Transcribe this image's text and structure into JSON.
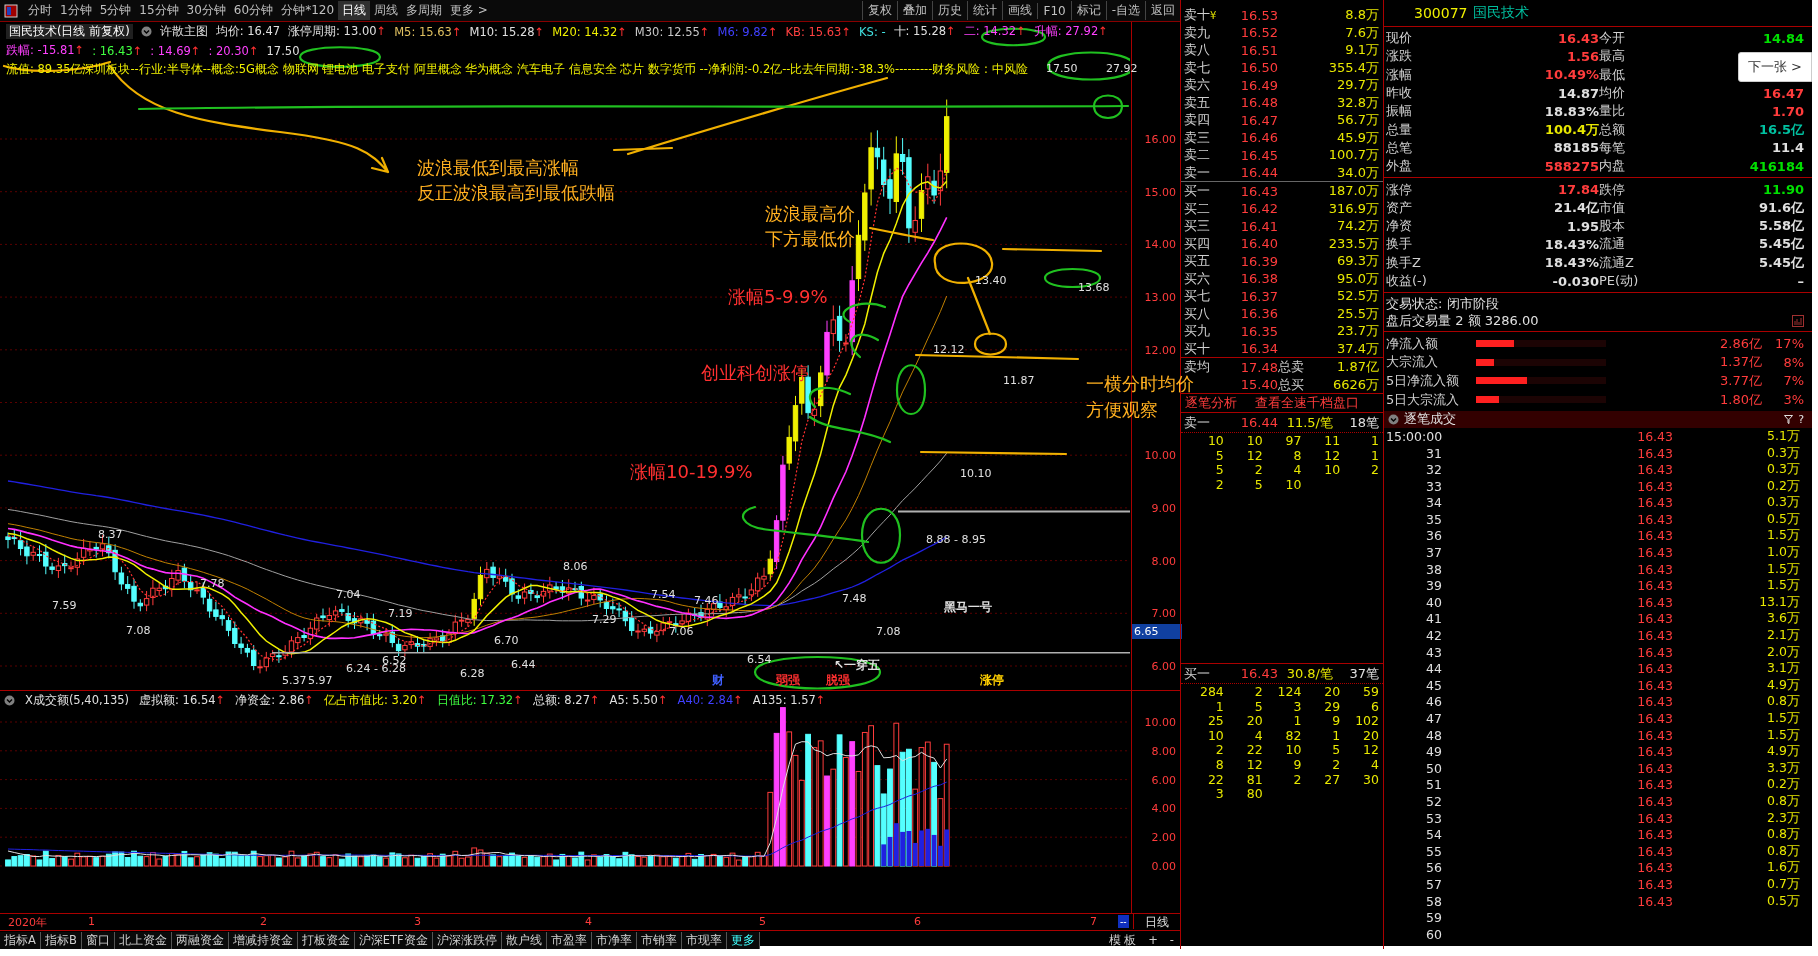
{
  "toolbar": {
    "periods": [
      {
        "label": "分时",
        "selected": false
      },
      {
        "label": "1分钟",
        "selected": false
      },
      {
        "label": "5分钟",
        "selected": false
      },
      {
        "label": "15分钟",
        "selected": false
      },
      {
        "label": "30分钟",
        "selected": false
      },
      {
        "label": "60分钟",
        "selected": false
      },
      {
        "label": "分钟*120",
        "selected": false
      },
      {
        "label": "日线",
        "selected": true
      },
      {
        "label": "周线",
        "selected": false
      },
      {
        "label": "多周期",
        "selected": false
      },
      {
        "label": "更多 >",
        "selected": false
      }
    ],
    "actions": [
      "复权",
      "叠加",
      "历史",
      "统计",
      "画线",
      "F10",
      "标记",
      "-自选",
      "返回"
    ]
  },
  "chart": {
    "title": "国民技术(日线 前复权)",
    "template": "许散主图",
    "indicators": [
      {
        "text": "均价: 16.47",
        "color": "#e0e0e0"
      },
      {
        "text": "涨停周期: 13.00",
        "arrow": "↑",
        "color": "#e0e0e0"
      },
      {
        "text": "M5: 15.63",
        "arrow": "↑",
        "color": "#e0c060"
      },
      {
        "text": "M10: 15.28",
        "arrow": "↑",
        "color": "#e0e0e0"
      },
      {
        "text": "M20: 14.32",
        "arrow": "↑",
        "color": "#f0f000"
      },
      {
        "text": "M30: 12.55",
        "arrow": "↑",
        "color": "#c8c8c8"
      },
      {
        "text": "M6: 9.82",
        "arrow": "↑",
        "color": "#4040ff"
      },
      {
        "text": "KB: 15.63",
        "arrow": "↑",
        "color": "#ff4040"
      },
      {
        "text": "KS: -",
        "color": "#40e0e0"
      },
      {
        "text": "十: 15.28",
        "arrow": "↑",
        "color": "#e0e0e0"
      },
      {
        "text": "二: 14.32",
        "arrow": "↑",
        "color": "#ff40ff"
      },
      {
        "text": "升幅: 27.92",
        "arrow": "↑",
        "color": "#ff40ff"
      }
    ],
    "indicators2": [
      {
        "text": "跌幅: -15.81",
        "arrow": "↑",
        "color": "#ff40ff"
      },
      {
        "text": ": 16.43",
        "arrow": "↑",
        "color": "#40ff40"
      },
      {
        "text": ": 14.69",
        "arrow": "↑",
        "color": "#ff40ff"
      },
      {
        "text": ": 20.30",
        "arrow": "↑",
        "color": "#ff40ff"
      },
      {
        "text": "17.50",
        "color": "#e0e0e0"
      }
    ],
    "info": "流值: 89.35亿深圳板块--行业:半导体--概念:5G概念 物联网 锂电池 电子支付 阿里概念 华为概念 汽车电子 信息安全 芯片 数字货币 --净利润:-0.2亿--比去年同期:-38.3%---------财务风险 : 中风险",
    "price_axis": [
      "16.00",
      "15.00",
      "14.00",
      "13.00",
      "12.00",
      "10.00",
      "9.00",
      "8.00",
      "7.00",
      "6.00"
    ],
    "current_price_marker": "6.65",
    "price_labels": [
      "8.37",
      "7.59",
      "7.78",
      "7.08",
      "5.37",
      "5.97",
      "7.04",
      "6.24 - 6.28",
      "7.19",
      "6.52",
      "6.28",
      "6.70",
      "6.44",
      "8.06",
      "7.29",
      "7.54",
      "7.46",
      "7.06",
      "6.54",
      "7.48",
      "7.08",
      "13.40",
      "12.12",
      "11.87",
      "10.10",
      "8.88 - 8.95",
      "17.50",
      "27.92",
      "13.68"
    ],
    "signals": [
      {
        "text": "黑马一号",
        "color": "#e0e0e0"
      },
      {
        "text": "↖一穿五",
        "color": "#e0e0e0"
      },
      {
        "text": "财",
        "color": "#4060ff"
      },
      {
        "text": "弱强",
        "color": "#ff3030"
      },
      {
        "text": "脱强",
        "color": "#ff3030"
      },
      {
        "text": "涨停",
        "color": "#ffd000"
      }
    ],
    "notes": [
      {
        "text": "波浪最低到最高涨幅",
        "color": "#ffb020"
      },
      {
        "text": "反正波浪最高到最低跌幅",
        "color": "#ffb020"
      },
      {
        "text": "波浪最高价",
        "color": "#ffb020"
      },
      {
        "text": "下方最低价",
        "color": "#ffb020"
      },
      {
        "text": "涨幅5-9.9%",
        "color": "#ff3030"
      },
      {
        "text": "创业科创涨停",
        "color": "#ff3030"
      },
      {
        "text": "涨幅10-19.9%",
        "color": "#ff3030"
      },
      {
        "text": "一横分时均价",
        "color": "#ffb020"
      },
      {
        "text": "方便观察",
        "color": "#ffb020"
      }
    ]
  },
  "volume": {
    "title": "X成交额(5,40,135)",
    "indicators": [
      {
        "text": "虚拟额: 16.54",
        "arrow": "↑",
        "color": "#e0e0e0"
      },
      {
        "text": "净资金: 2.86",
        "arrow": "↑",
        "color": "#e0e0e0"
      },
      {
        "text": "亿占市值比: 3.20",
        "arrow": "↑",
        "color": "#f0f000"
      },
      {
        "text": "日值比: 17.32",
        "arrow": "↑",
        "color": "#40ff40"
      },
      {
        "text": "总额: 8.27",
        "arrow": "↑",
        "color": "#e0e0e0"
      },
      {
        "text": "A5: 5.50",
        "arrow": "↑",
        "color": "#e0e0e0"
      },
      {
        "text": "A40: 2.84",
        "arrow": "↑",
        "color": "#4040ff"
      },
      {
        "text": "A135: 1.57",
        "arrow": "↑",
        "color": "#e0e0e0"
      }
    ],
    "axis": [
      "10.00",
      "8.00",
      "6.00",
      "4.00",
      "2.00",
      "0.00"
    ]
  },
  "date_axis": {
    "labels": [
      "2020年",
      "1",
      "2",
      "3",
      "4",
      "5",
      "6",
      "7"
    ],
    "scroll": "--",
    "period": "日线"
  },
  "bottom_tabs": [
    {
      "label": "指标A",
      "selected": false
    },
    {
      "label": "指标B",
      "selected": false
    },
    {
      "label": "窗口",
      "selected": false
    },
    {
      "label": "北上资金",
      "selected": false
    },
    {
      "label": "两融资金",
      "selected": false
    },
    {
      "label": "增减持资金",
      "selected": false
    },
    {
      "label": "打板资金",
      "selected": false
    },
    {
      "label": "沪深ETF资金",
      "selected": false
    },
    {
      "label": "沪深涨跌停",
      "selected": false
    },
    {
      "label": "散户线",
      "selected": false
    },
    {
      "label": "市盈率",
      "selected": false
    },
    {
      "label": "市净率",
      "selected": false
    },
    {
      "label": "市销率",
      "selected": false
    },
    {
      "label": "市现率",
      "selected": false
    },
    {
      "label": "更多",
      "selected": false
    }
  ],
  "bottom_buttons": [
    "模 板",
    "+",
    "-"
  ],
  "order_book": {
    "asks": [
      {
        "label": "卖十",
        "flag": "¥",
        "price": "16.53",
        "volume": "8.8万"
      },
      {
        "label": "卖九",
        "price": "16.52",
        "volume": "7.6万"
      },
      {
        "label": "卖八",
        "price": "16.51",
        "volume": "9.1万"
      },
      {
        "label": "卖七",
        "price": "16.50",
        "volume": "355.4万"
      },
      {
        "label": "卖六",
        "price": "16.49",
        "volume": "29.7万"
      },
      {
        "label": "卖五",
        "price": "16.48",
        "volume": "32.8万"
      },
      {
        "label": "卖四",
        "price": "16.47",
        "volume": "56.7万"
      },
      {
        "label": "卖三",
        "price": "16.46",
        "volume": "45.9万"
      },
      {
        "label": "卖二",
        "price": "16.45",
        "volume": "100.7万"
      },
      {
        "label": "卖一",
        "price": "16.44",
        "volume": "34.0万"
      }
    ],
    "bids": [
      {
        "label": "买一",
        "price": "16.43",
        "volume": "187.0万"
      },
      {
        "label": "买二",
        "price": "16.42",
        "volume": "316.9万"
      },
      {
        "label": "买三",
        "price": "16.41",
        "volume": "74.2万"
      },
      {
        "label": "买四",
        "price": "16.40",
        "volume": "233.5万"
      },
      {
        "label": "买五",
        "price": "16.39",
        "volume": "69.3万"
      },
      {
        "label": "买六",
        "price": "16.38",
        "volume": "95.0万"
      },
      {
        "label": "买七",
        "price": "16.37",
        "volume": "52.5万"
      },
      {
        "label": "买八",
        "price": "16.36",
        "volume": "25.5万"
      },
      {
        "label": "买九",
        "price": "16.35",
        "volume": "23.7万"
      },
      {
        "label": "买十",
        "price": "16.34",
        "volume": "37.4万"
      }
    ],
    "averages": [
      {
        "label": "卖均",
        "price": "17.48",
        "label2": "总卖",
        "value": "1.87亿"
      },
      {
        "price": "15.40",
        "label2": "总买",
        "value": "6626万"
      }
    ],
    "links": [
      "逐笔分析",
      "查看全速千档盘口"
    ],
    "ask_queue": {
      "label": "卖一",
      "price": "16.44",
      "per_order": "11.5/笔",
      "orders": "18笔",
      "rows": [
        [
          "10",
          "10",
          "97",
          "11",
          "1"
        ],
        [
          "5",
          "12",
          "8",
          "12",
          "1"
        ],
        [
          "5",
          "2",
          "4",
          "10",
          "2"
        ],
        [
          "2",
          "5",
          "10"
        ]
      ]
    },
    "bid_queue": {
      "label": "买一",
      "price": "16.43",
      "per_order": "30.8/笔",
      "orders": "37笔",
      "rows": [
        [
          "284",
          "2",
          "124",
          "20",
          "59"
        ],
        [
          "1",
          "5",
          "3",
          "29",
          "6"
        ],
        [
          "25",
          "20",
          "1",
          "9",
          "102"
        ],
        [
          "10",
          "4",
          "82",
          "1",
          "20"
        ],
        [
          "2",
          "22",
          "10",
          "5",
          "12"
        ],
        [
          "8",
          "12",
          "9",
          "2",
          "4"
        ],
        [
          "22",
          "81",
          "2",
          "27",
          "30"
        ],
        [
          "3",
          "80"
        ]
      ]
    }
  },
  "quote": {
    "code": "300077",
    "name": "国民技术",
    "next_button": "下一张 >",
    "rows": [
      [
        {
          "label": "现价",
          "value": "16.43",
          "color": "#ff3c3c"
        },
        {
          "label": "今开",
          "value": "14.84",
          "color": "#00e000"
        }
      ],
      [
        {
          "label": "涨跌",
          "value": "1.56",
          "color": "#ff3c3c"
        },
        {
          "label": "最高"
        }
      ],
      [
        {
          "label": "涨幅",
          "value": "10.49%",
          "color": "#ff3c3c"
        },
        {
          "label": "最低"
        }
      ],
      [
        {
          "label": "昨收",
          "value": "14.87",
          "color": "#e0e0e0"
        },
        {
          "label": "均价",
          "value": "16.47",
          "color": "#ff3c3c"
        }
      ],
      [
        {
          "label": "振幅",
          "value": "18.83%",
          "color": "#e0e0e0"
        },
        {
          "label": "量比",
          "value": "1.70",
          "color": "#ff3c3c"
        }
      ],
      [
        {
          "label": "总量",
          "value": "100.4万",
          "color": "#e8e800"
        },
        {
          "label": "总额",
          "value": "16.5亿",
          "color": "#00c0a0"
        }
      ],
      [
        {
          "label": "总笔",
          "value": "88185",
          "color": "#e0e0e0"
        },
        {
          "label": "每笔",
          "value": "11.4",
          "color": "#e0e0e0"
        }
      ],
      [
        {
          "label": "外盘",
          "value": "588275",
          "color": "#ff3c3c"
        },
        {
          "label": "内盘",
          "value": "416184",
          "color": "#00e000"
        }
      ]
    ],
    "rows2": [
      [
        {
          "label": "涨停",
          "value": "17.84",
          "color": "#ff3c3c"
        },
        {
          "label": "跌停",
          "value": "11.90",
          "color": "#00e000"
        }
      ],
      [
        {
          "label": "资产",
          "value": "21.4亿",
          "color": "#e0e0e0"
        },
        {
          "label": "市值",
          "value": "91.6亿",
          "color": "#e0e0e0"
        }
      ],
      [
        {
          "label": "净资",
          "value": "1.95",
          "color": "#e0e0e0"
        },
        {
          "label": "股本",
          "value": "5.58亿",
          "color": "#e0e0e0"
        }
      ],
      [
        {
          "label": "换手",
          "value": "18.43%",
          "color": "#e0e0e0"
        },
        {
          "label": "流通",
          "value": "5.45亿",
          "color": "#e0e0e0"
        }
      ],
      [
        {
          "label": "换手Z",
          "value": "18.43%",
          "color": "#e0e0e0"
        },
        {
          "label": "流通Z",
          "value": "5.45亿",
          "color": "#e0e0e0"
        }
      ],
      [
        {
          "label": "收益(-)",
          "value": "-0.030",
          "color": "#e0e0e0"
        },
        {
          "label": "PE(动)",
          "value": "–",
          "color": "#e0e0e0"
        }
      ]
    ],
    "status": "交易状态: 闭市阶段",
    "after_hours": "盘后交易量 2 额 3286.00"
  },
  "flows": [
    {
      "label": "净流入额",
      "level": 0.29,
      "value": "2.86亿",
      "share": "17%"
    },
    {
      "label": "大宗流入",
      "level": 0.14,
      "value": "1.37亿",
      "share": "8%"
    },
    {
      "label": "5日净流入额",
      "level": 0.39,
      "value": "3.77亿",
      "share": "7%"
    },
    {
      "label": "5日大宗流入",
      "level": 0.18,
      "value": "1.80亿",
      "share": "3%"
    }
  ],
  "trades": {
    "title": "逐笔成交",
    "help": "?",
    "rows": [
      {
        "time": "15:00:00",
        "price": "16.43",
        "volume": "5.1万"
      },
      {
        "time": "31",
        "price": "16.43",
        "volume": "0.3万"
      },
      {
        "time": "32",
        "price": "16.43",
        "volume": "0.3万"
      },
      {
        "time": "33",
        "price": "16.43",
        "volume": "0.2万"
      },
      {
        "time": "34",
        "price": "16.43",
        "volume": "0.3万"
      },
      {
        "time": "35",
        "price": "16.43",
        "volume": "0.5万"
      },
      {
        "time": "36",
        "price": "16.43",
        "volume": "1.5万"
      },
      {
        "time": "37",
        "price": "16.43",
        "volume": "1.0万"
      },
      {
        "time": "38",
        "price": "16.43",
        "volume": "1.5万"
      },
      {
        "time": "39",
        "price": "16.43",
        "volume": "1.5万"
      },
      {
        "time": "40",
        "price": "16.43",
        "volume": "13.1万"
      },
      {
        "time": "41",
        "price": "16.43",
        "volume": "3.6万"
      },
      {
        "time": "42",
        "price": "16.43",
        "volume": "2.1万"
      },
      {
        "time": "43",
        "price": "16.43",
        "volume": "2.0万"
      },
      {
        "time": "44",
        "price": "16.43",
        "volume": "3.1万"
      },
      {
        "time": "45",
        "price": "16.43",
        "volume": "4.9万"
      },
      {
        "time": "46",
        "price": "16.43",
        "volume": "0.8万"
      },
      {
        "time": "47",
        "price": "16.43",
        "volume": "1.5万"
      },
      {
        "time": "48",
        "price": "16.43",
        "volume": "1.5万"
      },
      {
        "time": "49",
        "price": "16.43",
        "volume": "4.9万"
      },
      {
        "time": "50",
        "price": "16.43",
        "volume": "3.3万"
      },
      {
        "time": "51",
        "price": "16.43",
        "volume": "0.2万"
      },
      {
        "time": "52",
        "price": "16.43",
        "volume": "0.8万"
      },
      {
        "time": "53",
        "price": "16.43",
        "volume": "2.3万"
      },
      {
        "time": "54",
        "price": "16.43",
        "volume": "0.8万"
      },
      {
        "time": "55",
        "price": "16.43",
        "volume": "0.8万"
      },
      {
        "time": "56",
        "price": "16.43",
        "volume": "1.6万"
      },
      {
        "time": "57",
        "price": "16.43",
        "volume": "0.7万"
      },
      {
        "time": "58",
        "price": "16.43",
        "volume": "0.5万"
      },
      {
        "time": "59"
      },
      {
        "time": "60"
      }
    ]
  }
}
